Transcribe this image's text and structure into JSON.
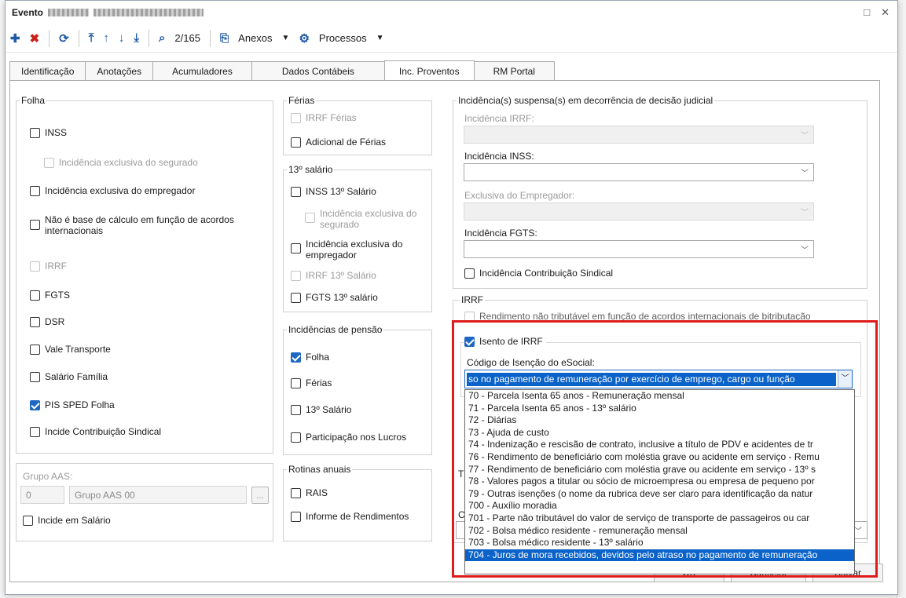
{
  "window": {
    "title": "Evento",
    "controls": [
      "□",
      "✕"
    ]
  },
  "toolbar": {
    "record_counter": "2/165",
    "anexos_label": "Anexos",
    "processos_label": "Processos"
  },
  "tabs": [
    {
      "label": "Identificação"
    },
    {
      "label": "Anotações"
    },
    {
      "label": "Acumuladores"
    },
    {
      "label": "Dados Contábeis"
    },
    {
      "label": "Inc. Proventos"
    },
    {
      "label": "RM Portal"
    }
  ],
  "folha": {
    "legend": "Folha",
    "inss": "INSS",
    "inc_exclusiva_segurado": "Incidência exclusiva do segurado",
    "inc_exclusiva_empregador": "Incidência exclusiva do empregador",
    "nao_base_calculo": "Não é base de cálculo em função de acordos internacionais",
    "irrf": "IRRF",
    "fgts": "FGTS",
    "dsr": "DSR",
    "vale_transporte": "Vale Transporte",
    "salario_familia": "Salário Família",
    "pis_sped": "PIS SPED Folha",
    "incide_contribuicao": "Incide Contribuição Sindical"
  },
  "grupo_aas": {
    "label": "Grupo AAS:",
    "code": "0",
    "name": "Grupo AAS 00",
    "browse": "...",
    "incide_salario": "Incide em Salário"
  },
  "ferias": {
    "legend": "Férias",
    "irrf_ferias": "IRRF Férias",
    "adicional_ferias": "Adicional de Férias"
  },
  "decimo": {
    "legend": "13º salário",
    "inss_13": "INSS 13º Salário",
    "inc_exclusiva_segurado": "Incidência exclusiva do segurado",
    "inc_exclusiva_empregador": "Incidência exclusiva do empregador",
    "irrf_13": "IRRF 13º Salário",
    "fgts_13": "FGTS 13º salário"
  },
  "pensao": {
    "legend": "Incidências de pensão",
    "folha": "Folha",
    "ferias": "Férias",
    "decimo": "13º Salário",
    "participacao": "Participação nos Lucros"
  },
  "rotinas": {
    "legend": "Rotinas anuais",
    "rais": "RAIS",
    "informe": "Informe de Rendimentos"
  },
  "suspensas": {
    "legend": "Incidência(s) suspensa(s) em decorrência de decisão judicial",
    "irrf_label": "Incidência IRRF:",
    "inss_label": "Incidência INSS:",
    "exclusiva_label": "Exclusiva do Empregador:",
    "fgts_label": "Incidência FGTS:",
    "contribuicao_sindical": "Incidência Contribuição Sindical"
  },
  "irrf_group": {
    "legend": "IRRF",
    "rendimento_nao_tributavel": "Rendimento não tributável em função de acordos internacionais de bitributação",
    "isento": "Isento de IRRF",
    "codigo_label": "Código de Isenção do eSocial:",
    "codigo_value": "so no pagamento de remuneração por exercício de emprego, cargo ou função",
    "options": [
      "70 - Parcela Isenta 65 anos - Remuneração mensal",
      "71 - Parcela Isenta 65 anos - 13º salário",
      "72 - Diárias",
      "73 - Ajuda de custo",
      "74 - Indenização e rescisão de contrato, inclusive a título de PDV e acidentes de tr",
      "76 - Rendimento de beneficiário com moléstia grave ou acidente em serviço - Remu",
      "77 - Rendimento de beneficiário com moléstia grave ou acidente em serviço - 13º s",
      "78 - Valores pagos a titular ou sócio de microempresa ou empresa de pequeno por",
      "79 - Outras isenções (o nome da rubrica deve ser claro para identificação da natur",
      "700 - Auxílio moradia",
      "701 - Parte não tributável do valor de serviço de transporte de passageiros ou car",
      "702 - Bolsa médico residente - remuneração mensal",
      "703 - Bolsa médico residente - 13º salário",
      "704 - Juros de mora recebidos, devidos pelo atraso no pagamento de remuneração"
    ],
    "selected_index": 13
  },
  "partial_labels": {
    "t": "T",
    "c": "C"
  },
  "footer": {
    "ok": "OK",
    "cancelar": "Cancelar",
    "salvar": "Salvar"
  },
  "colors": {
    "accent": "#1f67c3",
    "highlight_border": "#e01b1b",
    "selection": "#0b63c9"
  }
}
